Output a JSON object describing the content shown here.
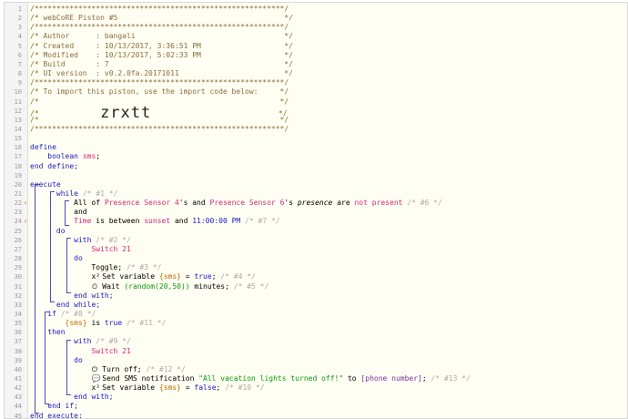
{
  "lines": [
    {
      "n": "1",
      "segs": [
        [
          "c",
          "/*********************************************************/"
        ]
      ]
    },
    {
      "n": "2",
      "segs": [
        [
          "c",
          "/* webCoRE Piston #5                                      */"
        ]
      ]
    },
    {
      "n": "3",
      "segs": [
        [
          "c",
          "/*********************************************************/"
        ]
      ]
    },
    {
      "n": "4",
      "segs": [
        [
          "c",
          "/* Author      : bangali                                  */"
        ]
      ]
    },
    {
      "n": "5",
      "segs": [
        [
          "c",
          "/* Created     : 10/13/2017, 3:36:51 PM                   */"
        ]
      ]
    },
    {
      "n": "6",
      "segs": [
        [
          "c",
          "/* Modified    : 10/13/2017, 5:02:33 PM                   */"
        ]
      ]
    },
    {
      "n": "7",
      "segs": [
        [
          "c",
          "/* Build       : 7                                        */"
        ]
      ]
    },
    {
      "n": "8",
      "segs": [
        [
          "c",
          "/* UI version  : v0.2.0fa.20171011                        */"
        ]
      ]
    },
    {
      "n": "9",
      "segs": [
        [
          "c",
          "/*********************************************************/"
        ]
      ]
    },
    {
      "n": "10",
      "segs": [
        [
          "c",
          "/* To import this piston, use the import code below:     */"
        ]
      ]
    },
    {
      "n": "11",
      "segs": [
        [
          "c",
          "/*                                                       */"
        ]
      ]
    },
    {
      "n": "12",
      "segs": [
        [
          "c",
          "/*              "
        ],
        [
          "big",
          "zrxtt"
        ],
        [
          "c",
          "                             */"
        ]
      ]
    },
    {
      "n": "13",
      "segs": [
        [
          "c",
          "/*                                                       */"
        ]
      ]
    },
    {
      "n": "14",
      "segs": [
        [
          "c",
          "/*********************************************************/"
        ]
      ]
    },
    {
      "n": "15",
      "segs": []
    },
    {
      "n": "16",
      "segs": [
        [
          "k",
          "define"
        ]
      ]
    },
    {
      "n": "17",
      "segs": [
        [
          "t",
          "    "
        ],
        [
          "k",
          "boolean"
        ],
        [
          "t",
          " "
        ],
        [
          "d",
          "sms"
        ],
        [
          "t",
          ";"
        ]
      ]
    },
    {
      "n": "18",
      "segs": [
        [
          "k",
          "end define;"
        ]
      ]
    },
    {
      "n": "19",
      "segs": []
    },
    {
      "n": "20",
      "segs": [
        [
          "k",
          "execute"
        ]
      ]
    },
    {
      "n": "21",
      "segs": [
        [
          "t",
          "      "
        ],
        [
          "k",
          "while"
        ],
        [
          "t",
          " "
        ],
        [
          "cm",
          "/* #1 */"
        ]
      ]
    },
    {
      "n": "22",
      "mark": "⚡",
      "segs": [
        [
          "t",
          "          All of "
        ],
        [
          "p",
          "Presence Sensor 4"
        ],
        [
          "t",
          "'s and "
        ],
        [
          "p",
          "Presence Sensor 6"
        ],
        [
          "t",
          "'s "
        ],
        [
          "i",
          "presence"
        ],
        [
          "t",
          " are "
        ],
        [
          "d",
          "not present"
        ],
        [
          "t",
          " "
        ],
        [
          "cm",
          "/* #6 */"
        ]
      ]
    },
    {
      "n": "23",
      "segs": [
        [
          "t",
          "          and"
        ]
      ]
    },
    {
      "n": "24",
      "mark": "⚡",
      "segs": [
        [
          "t",
          "          "
        ],
        [
          "d",
          "Time"
        ],
        [
          "t",
          " is between "
        ],
        [
          "d",
          "sunset"
        ],
        [
          "t",
          " and "
        ],
        [
          "k",
          "11:00:00 PM"
        ],
        [
          "t",
          " "
        ],
        [
          "cm",
          "/* #7 */"
        ]
      ]
    },
    {
      "n": "25",
      "segs": [
        [
          "t",
          "      "
        ],
        [
          "k",
          "do"
        ]
      ]
    },
    {
      "n": "26",
      "segs": [
        [
          "t",
          "          "
        ],
        [
          "k",
          "with"
        ],
        [
          "t",
          " "
        ],
        [
          "cm",
          "/* #2 */"
        ]
      ]
    },
    {
      "n": "27",
      "segs": [
        [
          "t",
          "              "
        ],
        [
          "d",
          "Switch 21"
        ]
      ]
    },
    {
      "n": "28",
      "segs": [
        [
          "t",
          "          "
        ],
        [
          "k",
          "do"
        ]
      ]
    },
    {
      "n": "29",
      "segs": [
        [
          "t",
          "              Toggle; "
        ],
        [
          "cm",
          "/* #3 */"
        ]
      ]
    },
    {
      "n": "30",
      "segs": [
        [
          "t",
          "              "
        ],
        [
          "ic",
          "x²"
        ],
        [
          "t",
          " Set variable "
        ],
        [
          "v",
          "{sms}"
        ],
        [
          "t",
          " = "
        ],
        [
          "k",
          "true"
        ],
        [
          "t",
          "; "
        ],
        [
          "cm",
          "/* #4 */"
        ]
      ]
    },
    {
      "n": "31",
      "segs": [
        [
          "t",
          "              "
        ],
        [
          "ic",
          "⏲"
        ],
        [
          "t",
          " Wait "
        ],
        [
          "s",
          "(random(20,50))"
        ],
        [
          "t",
          " minutes; "
        ],
        [
          "cm",
          "/* #5 */"
        ]
      ]
    },
    {
      "n": "32",
      "segs": [
        [
          "t",
          "          "
        ],
        [
          "k",
          "end with;"
        ]
      ]
    },
    {
      "n": "33",
      "segs": [
        [
          "t",
          "      "
        ],
        [
          "k",
          "end while;"
        ]
      ]
    },
    {
      "n": "34",
      "segs": [
        [
          "t",
          "    "
        ],
        [
          "k",
          "if"
        ],
        [
          "t",
          " "
        ],
        [
          "cm",
          "/* #8 */"
        ]
      ]
    },
    {
      "n": "35",
      "segs": [
        [
          "t",
          "        "
        ],
        [
          "v",
          "{sms}"
        ],
        [
          "t",
          " is "
        ],
        [
          "k",
          "true"
        ],
        [
          "t",
          " "
        ],
        [
          "cm",
          "/* #11 */"
        ]
      ]
    },
    {
      "n": "36",
      "segs": [
        [
          "t",
          "    "
        ],
        [
          "k",
          "then"
        ]
      ]
    },
    {
      "n": "37",
      "segs": [
        [
          "t",
          "          "
        ],
        [
          "k",
          "with"
        ],
        [
          "t",
          " "
        ],
        [
          "cm",
          "/* #9 */"
        ]
      ]
    },
    {
      "n": "38",
      "segs": [
        [
          "t",
          "              "
        ],
        [
          "d",
          "Switch 21"
        ]
      ]
    },
    {
      "n": "39",
      "segs": [
        [
          "t",
          "          "
        ],
        [
          "k",
          "do"
        ]
      ]
    },
    {
      "n": "40",
      "segs": [
        [
          "t",
          "              "
        ],
        [
          "ic",
          "⏻"
        ],
        [
          "t",
          " Turn off; "
        ],
        [
          "cm",
          "/* #12 */"
        ]
      ]
    },
    {
      "n": "41",
      "segs": [
        [
          "t",
          "              "
        ],
        [
          "ic",
          "💬"
        ],
        [
          "t",
          " Send SMS notification "
        ],
        [
          "s",
          "\"All vacation lights turned off!\""
        ],
        [
          "t",
          " to "
        ],
        [
          "fn",
          "[phone number]"
        ],
        [
          "t",
          "; "
        ],
        [
          "cm",
          "/* #13 */"
        ]
      ]
    },
    {
      "n": "42",
      "segs": [
        [
          "t",
          "              "
        ],
        [
          "ic",
          "x²"
        ],
        [
          "t",
          " Set variable "
        ],
        [
          "v",
          "{sms}"
        ],
        [
          "t",
          " = "
        ],
        [
          "k",
          "false"
        ],
        [
          "t",
          "; "
        ],
        [
          "cm",
          "/* #10 */"
        ]
      ]
    },
    {
      "n": "43",
      "segs": [
        [
          "t",
          "          "
        ],
        [
          "k",
          "end with;"
        ]
      ]
    },
    {
      "n": "44",
      "segs": [
        [
          "t",
          "    "
        ],
        [
          "k",
          "end if;"
        ]
      ]
    },
    {
      "n": "45",
      "segs": [
        [
          "k",
          "end execute;"
        ]
      ]
    }
  ]
}
